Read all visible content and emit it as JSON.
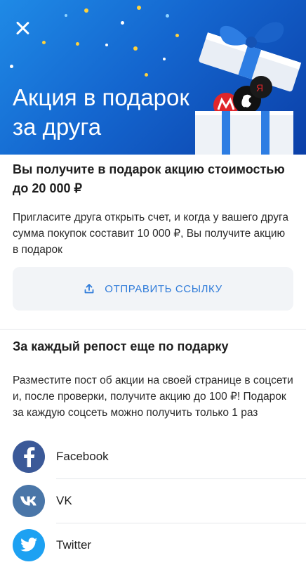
{
  "hero": {
    "title": "Акция в подарок за друга",
    "colors": {
      "gradient_start": "#1f8ae6",
      "gradient_end": "#0b3fa8"
    }
  },
  "invite": {
    "heading": "Вы получите в подарок акцию стоимостью до 20 000 ₽",
    "description": "Пригласите друга открыть счет, и когда у вашего друга сумма покупок составит 10 000 ₽, Вы получите акцию в подарок",
    "share_button": {
      "icon": "share-upload-icon",
      "label": "ОТПРАВИТЬ ССЫЛКУ"
    }
  },
  "repost": {
    "heading": "За каждый репост еще по подарку",
    "description": "Разместите пост об акции на своей странице в соцсети и, после проверки, получите акцию до 100 ₽! Подарок за каждую соцсеть можно получить только 1 раз"
  },
  "socials": [
    {
      "label": "Facebook",
      "icon": "facebook-icon",
      "color": "#3b5998"
    },
    {
      "label": "VK",
      "icon": "vk-icon",
      "color": "#4a76a8"
    },
    {
      "label": "Twitter",
      "icon": "twitter-icon",
      "color": "#1da1f2"
    }
  ],
  "accent_color": "#2f7bd9"
}
